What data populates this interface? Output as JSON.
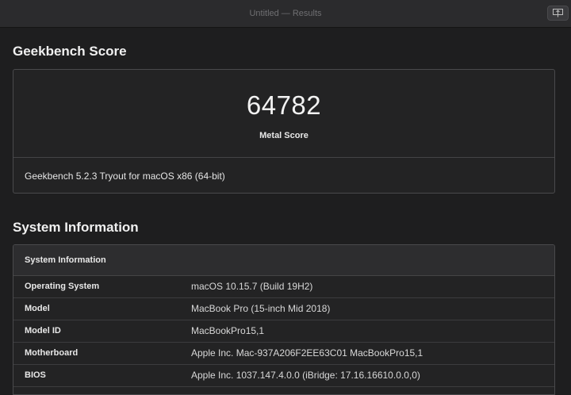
{
  "window": {
    "title": "Untitled — Results",
    "share_icon": "share-icon"
  },
  "score_section": {
    "heading": "Geekbench Score",
    "score": "64782",
    "score_label": "Metal Score",
    "version": "Geekbench 5.2.3 Tryout for macOS x86 (64-bit)"
  },
  "system_section": {
    "heading": "System Information",
    "table_header": "System Information",
    "rows": [
      {
        "key": "Operating System",
        "value": "macOS 10.15.7 (Build 19H2)"
      },
      {
        "key": "Model",
        "value": "MacBook Pro (15-inch Mid 2018)"
      },
      {
        "key": "Model ID",
        "value": "MacBookPro15,1"
      },
      {
        "key": "Motherboard",
        "value": "Apple Inc. Mac-937A206F2EE63C01 MacBookPro15,1"
      },
      {
        "key": "BIOS",
        "value": "Apple Inc. 1037.147.4.0.0 (iBridge: 17.16.16610.0.0,0)"
      }
    ]
  }
}
